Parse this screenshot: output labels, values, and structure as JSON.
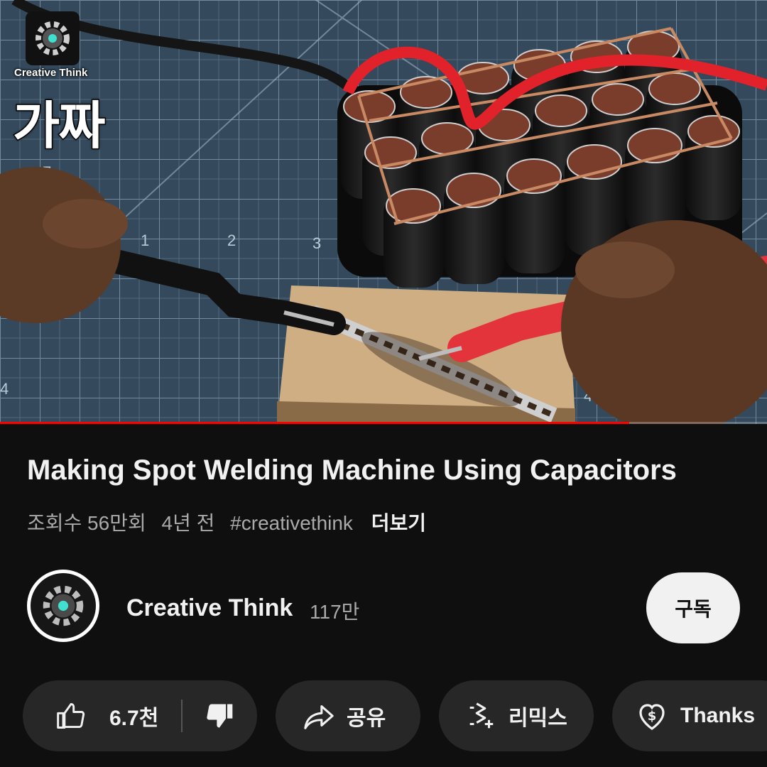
{
  "video": {
    "watermark_text": "Creative Think",
    "overlay_caption": "가짜",
    "progress": 0.82
  },
  "info": {
    "title": "Making Spot Welding Machine Using Capacitors",
    "views": "조회수 56만회",
    "age": "4년 전",
    "hashtag": "#creativethink",
    "more_label": "더보기"
  },
  "channel": {
    "name": "Creative Think",
    "subscribers": "117만",
    "subscribe_label": "구독"
  },
  "actions": {
    "like_count": "6.7천",
    "share_label": "공유",
    "remix_label": "리믹스",
    "thanks_label": "Thanks"
  },
  "icons": {
    "like": "thumbs-up-icon",
    "dislike": "thumbs-down-icon",
    "share": "share-arrow-icon",
    "remix": "remix-icon",
    "thanks": "heart-dollar-icon"
  },
  "colors": {
    "background": "#0f0f0f",
    "chip": "#272727",
    "progress": "#ff0000",
    "subscribe_bg": "#f1f1f1"
  }
}
